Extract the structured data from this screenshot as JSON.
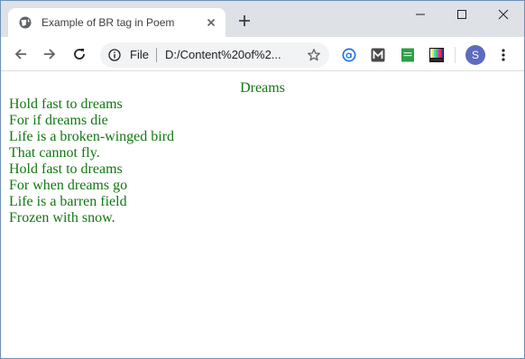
{
  "browser": {
    "tab": {
      "title": "Example of BR tag in Poem",
      "favicon": "globe-icon"
    },
    "address_bar": {
      "scheme_label": "File",
      "url": "D:/Content%20of%2..."
    },
    "profile_initial": "S",
    "extensions": [
      "a-circle-icon",
      "m-logo-icon",
      "green-doc-icon",
      "color-bars-icon"
    ]
  },
  "page": {
    "title": "Dreams",
    "lines": [
      "Hold fast to dreams",
      "For if dreams die",
      "Life is a broken-winged bird",
      "That cannot fly.",
      "Hold fast to dreams",
      "For when dreams go",
      "Life is a barren field",
      "Frozen with snow."
    ],
    "text_color": "#117711"
  },
  "colors": {
    "titlebar": "#dee1e6",
    "omnibox": "#f1f3f4",
    "avatar": "#5c6bc0"
  }
}
